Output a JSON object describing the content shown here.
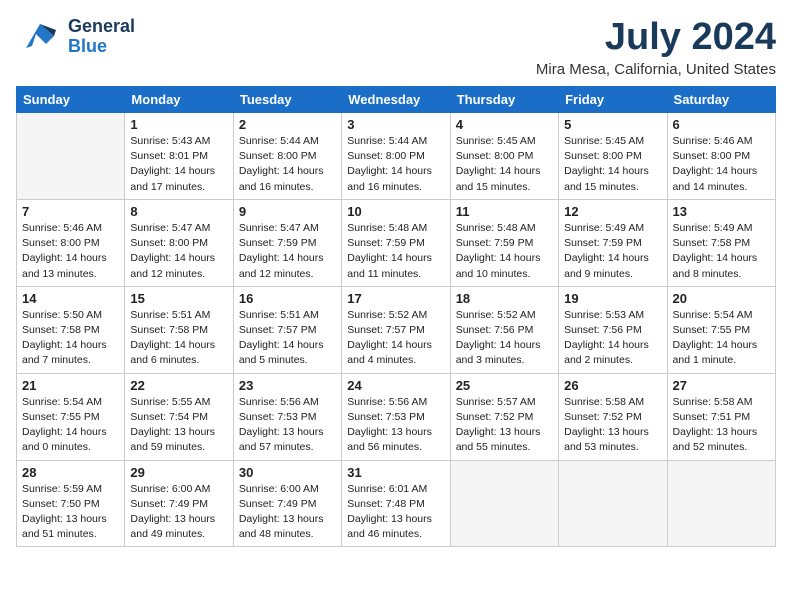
{
  "header": {
    "logo_general": "General",
    "logo_blue": "Blue",
    "month_title": "July 2024",
    "location": "Mira Mesa, California, United States"
  },
  "days_of_week": [
    "Sunday",
    "Monday",
    "Tuesday",
    "Wednesday",
    "Thursday",
    "Friday",
    "Saturday"
  ],
  "weeks": [
    [
      {
        "day": "",
        "info": ""
      },
      {
        "day": "1",
        "info": "Sunrise: 5:43 AM\nSunset: 8:01 PM\nDaylight: 14 hours\nand 17 minutes."
      },
      {
        "day": "2",
        "info": "Sunrise: 5:44 AM\nSunset: 8:00 PM\nDaylight: 14 hours\nand 16 minutes."
      },
      {
        "day": "3",
        "info": "Sunrise: 5:44 AM\nSunset: 8:00 PM\nDaylight: 14 hours\nand 16 minutes."
      },
      {
        "day": "4",
        "info": "Sunrise: 5:45 AM\nSunset: 8:00 PM\nDaylight: 14 hours\nand 15 minutes."
      },
      {
        "day": "5",
        "info": "Sunrise: 5:45 AM\nSunset: 8:00 PM\nDaylight: 14 hours\nand 15 minutes."
      },
      {
        "day": "6",
        "info": "Sunrise: 5:46 AM\nSunset: 8:00 PM\nDaylight: 14 hours\nand 14 minutes."
      }
    ],
    [
      {
        "day": "7",
        "info": "Sunrise: 5:46 AM\nSunset: 8:00 PM\nDaylight: 14 hours\nand 13 minutes."
      },
      {
        "day": "8",
        "info": "Sunrise: 5:47 AM\nSunset: 8:00 PM\nDaylight: 14 hours\nand 12 minutes."
      },
      {
        "day": "9",
        "info": "Sunrise: 5:47 AM\nSunset: 7:59 PM\nDaylight: 14 hours\nand 12 minutes."
      },
      {
        "day": "10",
        "info": "Sunrise: 5:48 AM\nSunset: 7:59 PM\nDaylight: 14 hours\nand 11 minutes."
      },
      {
        "day": "11",
        "info": "Sunrise: 5:48 AM\nSunset: 7:59 PM\nDaylight: 14 hours\nand 10 minutes."
      },
      {
        "day": "12",
        "info": "Sunrise: 5:49 AM\nSunset: 7:59 PM\nDaylight: 14 hours\nand 9 minutes."
      },
      {
        "day": "13",
        "info": "Sunrise: 5:49 AM\nSunset: 7:58 PM\nDaylight: 14 hours\nand 8 minutes."
      }
    ],
    [
      {
        "day": "14",
        "info": "Sunrise: 5:50 AM\nSunset: 7:58 PM\nDaylight: 14 hours\nand 7 minutes."
      },
      {
        "day": "15",
        "info": "Sunrise: 5:51 AM\nSunset: 7:58 PM\nDaylight: 14 hours\nand 6 minutes."
      },
      {
        "day": "16",
        "info": "Sunrise: 5:51 AM\nSunset: 7:57 PM\nDaylight: 14 hours\nand 5 minutes."
      },
      {
        "day": "17",
        "info": "Sunrise: 5:52 AM\nSunset: 7:57 PM\nDaylight: 14 hours\nand 4 minutes."
      },
      {
        "day": "18",
        "info": "Sunrise: 5:52 AM\nSunset: 7:56 PM\nDaylight: 14 hours\nand 3 minutes."
      },
      {
        "day": "19",
        "info": "Sunrise: 5:53 AM\nSunset: 7:56 PM\nDaylight: 14 hours\nand 2 minutes."
      },
      {
        "day": "20",
        "info": "Sunrise: 5:54 AM\nSunset: 7:55 PM\nDaylight: 14 hours\nand 1 minute."
      }
    ],
    [
      {
        "day": "21",
        "info": "Sunrise: 5:54 AM\nSunset: 7:55 PM\nDaylight: 14 hours\nand 0 minutes."
      },
      {
        "day": "22",
        "info": "Sunrise: 5:55 AM\nSunset: 7:54 PM\nDaylight: 13 hours\nand 59 minutes."
      },
      {
        "day": "23",
        "info": "Sunrise: 5:56 AM\nSunset: 7:53 PM\nDaylight: 13 hours\nand 57 minutes."
      },
      {
        "day": "24",
        "info": "Sunrise: 5:56 AM\nSunset: 7:53 PM\nDaylight: 13 hours\nand 56 minutes."
      },
      {
        "day": "25",
        "info": "Sunrise: 5:57 AM\nSunset: 7:52 PM\nDaylight: 13 hours\nand 55 minutes."
      },
      {
        "day": "26",
        "info": "Sunrise: 5:58 AM\nSunset: 7:52 PM\nDaylight: 13 hours\nand 53 minutes."
      },
      {
        "day": "27",
        "info": "Sunrise: 5:58 AM\nSunset: 7:51 PM\nDaylight: 13 hours\nand 52 minutes."
      }
    ],
    [
      {
        "day": "28",
        "info": "Sunrise: 5:59 AM\nSunset: 7:50 PM\nDaylight: 13 hours\nand 51 minutes."
      },
      {
        "day": "29",
        "info": "Sunrise: 6:00 AM\nSunset: 7:49 PM\nDaylight: 13 hours\nand 49 minutes."
      },
      {
        "day": "30",
        "info": "Sunrise: 6:00 AM\nSunset: 7:49 PM\nDaylight: 13 hours\nand 48 minutes."
      },
      {
        "day": "31",
        "info": "Sunrise: 6:01 AM\nSunset: 7:48 PM\nDaylight: 13 hours\nand 46 minutes."
      },
      {
        "day": "",
        "info": ""
      },
      {
        "day": "",
        "info": ""
      },
      {
        "day": "",
        "info": ""
      }
    ]
  ]
}
